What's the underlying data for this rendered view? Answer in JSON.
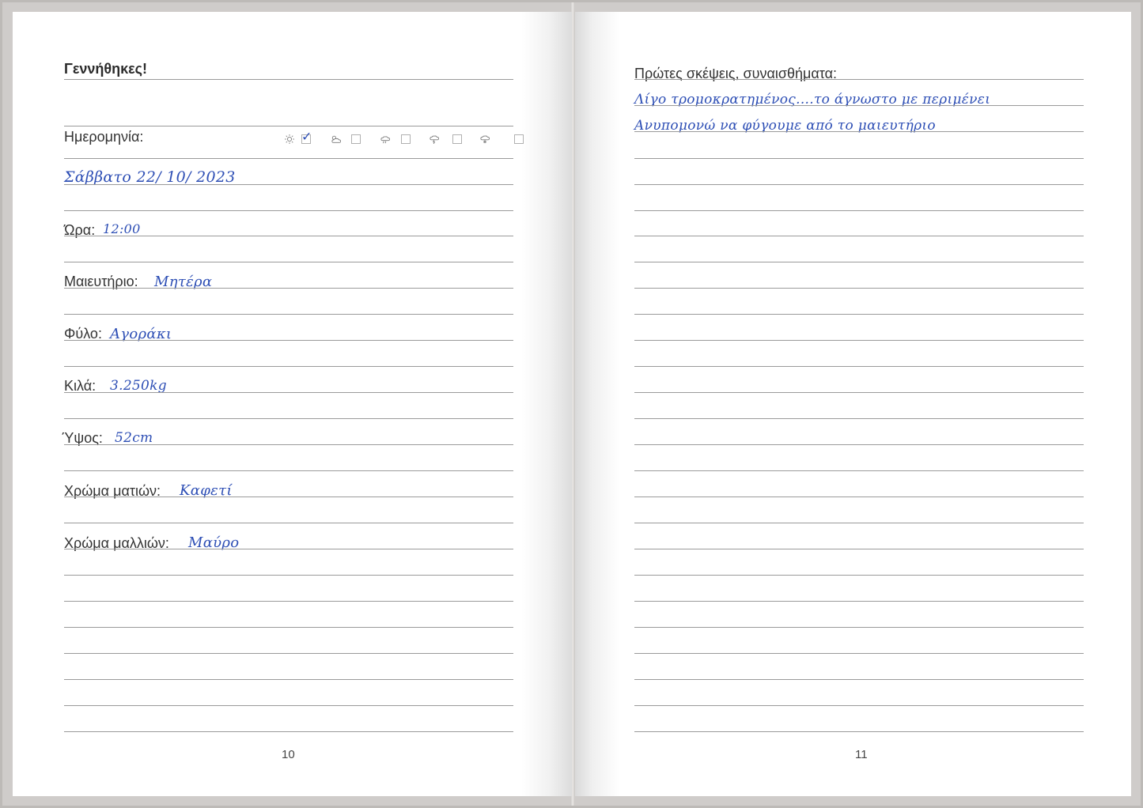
{
  "left_page": {
    "heading": "Γεννήθηκες!",
    "date_label": "Ημερομηνία:",
    "date_value": "Σάββατο 22/ 10/ 2023",
    "time_label": "Ώρα:",
    "time_value": "12:00",
    "maternity_label": "Μαιευτήριο:",
    "maternity_value": "Μητέρα",
    "sex_label": "Φύλο:",
    "sex_value": "Αγοράκι",
    "weight_label": "Κιλά:",
    "weight_value": "3.250kg",
    "height_label": "Ύψος:",
    "height_value": "52cm",
    "eye_color_label": "Χρώμα ματιών:",
    "eye_color_value": "Καφετί",
    "hair_color_label": "Χρώμα μαλλιών:",
    "hair_color_value": "Μαύρο",
    "page_number": "10",
    "weather": [
      {
        "icon": "sun-icon",
        "checked": true
      },
      {
        "icon": "partly-cloudy-icon",
        "checked": false
      },
      {
        "icon": "rain-cloud-icon",
        "checked": false
      },
      {
        "icon": "storm-cloud-icon",
        "checked": false
      },
      {
        "icon": "snow-cloud-icon",
        "checked": false
      }
    ]
  },
  "right_page": {
    "heading": "Πρώτες σκέψεις, συναισθήματα:",
    "line1": "Λίγο τρομοκρατημένος....το άγνωστο με περιμένει",
    "line2": "Ανυπομονώ να φύγουμε από το μαιευτήριο",
    "page_number": "11"
  },
  "colors": {
    "ink": "#2e4fb5",
    "rule": "#9a9a9a",
    "paper": "#ffffff"
  }
}
